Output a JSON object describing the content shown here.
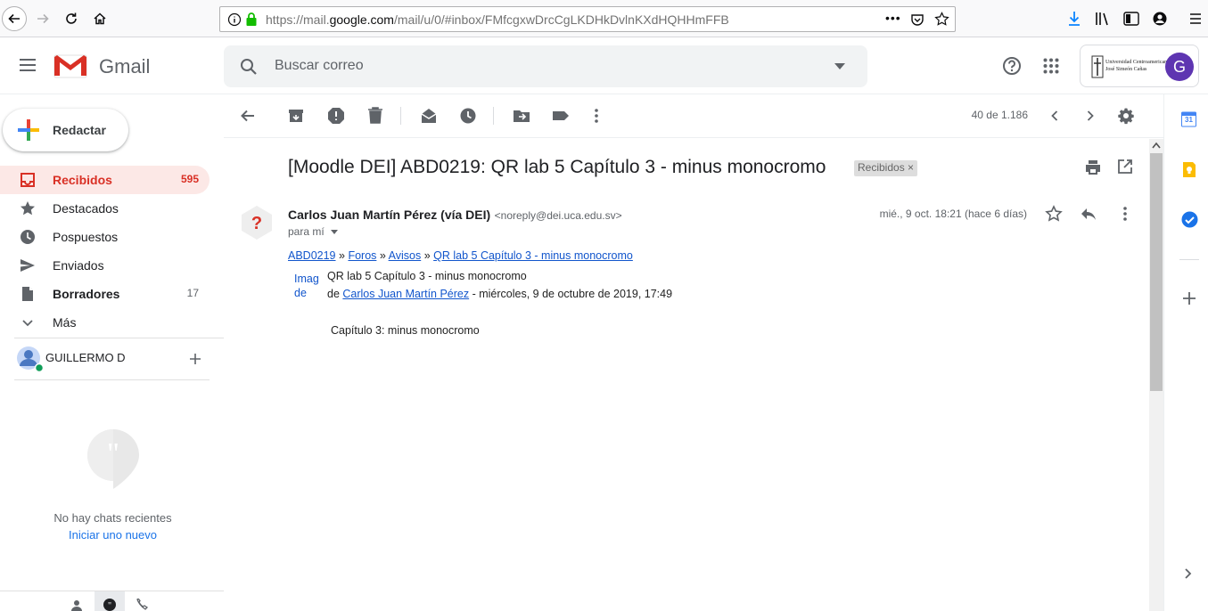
{
  "browser": {
    "url_prefix": "https://mail.",
    "url_domain": "google.com",
    "url_suffix": "/mail/u/0/#inbox/FMfcgxwDrcCgLKDHkDvlnKXdHQHHmFFB"
  },
  "header": {
    "app_name": "Gmail",
    "search_placeholder": "Buscar correo",
    "org_name_line1": "Universidad Centroamericana",
    "org_name_line2": "José Simeón Cañas",
    "avatar_letter": "G"
  },
  "sidebar": {
    "compose_label": "Redactar",
    "items": [
      {
        "label": "Recibidos",
        "count": "595"
      },
      {
        "label": "Destacados",
        "count": ""
      },
      {
        "label": "Pospuestos",
        "count": ""
      },
      {
        "label": "Enviados",
        "count": ""
      },
      {
        "label": "Borradores",
        "count": "17"
      },
      {
        "label": "Más",
        "count": ""
      }
    ],
    "hangouts_user": "GUILLERMO D.",
    "no_chats": "No hay chats recientes",
    "start_new": "Iniciar uno nuevo"
  },
  "toolbar": {
    "pagination": "40 de 1.186"
  },
  "email": {
    "subject": "[Moodle DEI] ABD0219: QR lab 5 Capítulo 3 - minus monocromo",
    "label_chip": "Recibidos",
    "sender_name": "Carlos Juan Martín Pérez (vía DEI)",
    "sender_email": "<noreply@dei.uca.edu.sv>",
    "to_line": "para mí",
    "date": "mié., 9 oct. 18:21 (hace 6 días)",
    "breadcrumb": [
      "ABD0219",
      "Foros",
      "Avisos",
      "QR lab 5 Capítulo 3 - minus monocromo"
    ],
    "breadcrumb_sep": "»",
    "image_alt": "Imagen de",
    "post_title": "QR lab 5 Capítulo 3 - minus monocromo",
    "post_by_prefix": "de",
    "post_author": "Carlos Juan Martín Pérez",
    "post_date": "- miércoles, 9 de octubre de 2019, 17:49",
    "body": "Capítulo 3: minus monocromo"
  },
  "addons": {
    "calendar_day": "31"
  },
  "colors": {
    "accent_red": "#d93025",
    "inbox_bg": "#fce8e6",
    "link": "#1155cc",
    "avatar_bg": "#5e35b1"
  }
}
